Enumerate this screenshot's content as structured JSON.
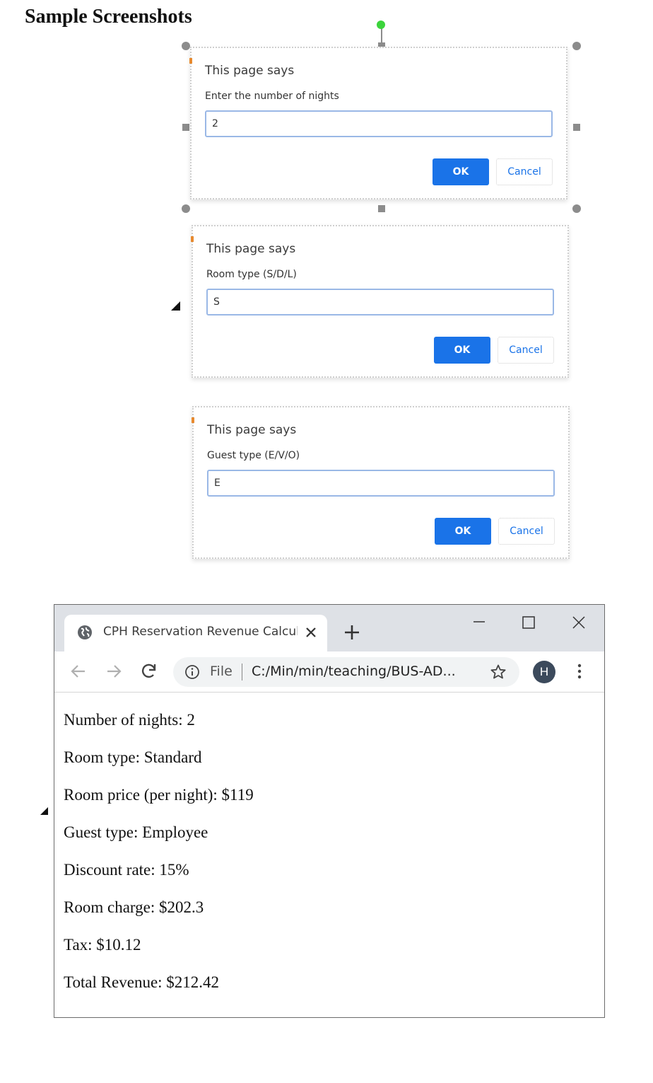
{
  "heading": "Sample Screenshots",
  "dialogs": [
    {
      "title": "This page says",
      "message": "Enter the number of nights",
      "input_value": "2",
      "ok_label": "OK",
      "cancel_label": "Cancel"
    },
    {
      "title": "This page says",
      "message": "Room type (S/D/L)",
      "input_value": "S",
      "ok_label": "OK",
      "cancel_label": "Cancel"
    },
    {
      "title": "This page says",
      "message": "Guest type (E/V/O)",
      "input_value": "E",
      "ok_label": "OK",
      "cancel_label": "Cancel"
    }
  ],
  "browser": {
    "tab_title": "CPH Reservation Revenue Calcula",
    "tab_icon": "globe-icon",
    "url_scheme_label": "File",
    "url": "C:/Min/min/teaching/BUS-AD...",
    "avatar_initial": "H",
    "accent_color": "#1a73e8"
  },
  "output_lines": [
    "Number of nights: 2",
    "Room type: Standard",
    "Room price (per night): $119",
    "Guest type: Employee",
    "Discount rate: 15%",
    "Room charge: $202.3",
    "Tax: $10.12",
    "Total Revenue: $212.42"
  ]
}
